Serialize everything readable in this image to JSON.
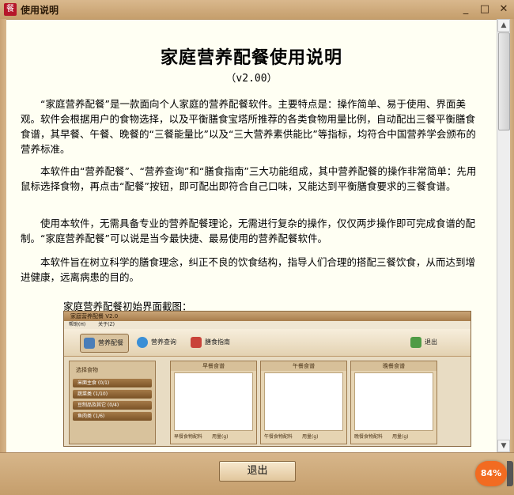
{
  "window": {
    "title": "使用说明",
    "icon": "餐",
    "min_icon": "_",
    "max_icon": "□",
    "close_icon": "✕"
  },
  "doc": {
    "title": "家庭营养配餐使用说明",
    "version": "（v2.00）",
    "paragraphs": [
      "“家庭营养配餐”是一款面向个人家庭的营养配餐软件。主要特点是：操作简单、易于使用、界面美观。软件会根据用户的食物选择，以及平衡膳食宝塔所推荐的各类食物用量比例，自动配出三餐平衡膳食食谱，其早餐、午餐、晚餐的“三餐能量比”以及“三大营养素供能比”等指标，均符合中国营养学会颁布的营养标准。",
      "本软件由“营养配餐”、“营养查询”和“膳食指南”三大功能组成，其中营养配餐的操作非常简单：先用鼠标选择食物，再点击“配餐”按钮，即可配出即符合自己口味，又能达到平衡膳食要求的三餐食谱。",
      "使用本软件，无需具备专业的营养配餐理论，无需进行复杂的操作，仅仅两步操作即可完成食谱的配制。“家庭营养配餐”可以说是当今最快捷、最易使用的营养配餐软件。",
      "本软件旨在树立科学的膳食理念，纠正不良的饮食结构，指导人们合理的搭配三餐饮食，从而达到增进健康，远离病患的目的。"
    ],
    "caption": "家庭营养配餐初始界面截图："
  },
  "screenshot": {
    "title": "家庭营养配餐 V2.0",
    "menu": [
      "帮助(H)",
      "关于(Z)"
    ],
    "toolbar": {
      "peican": "营养配餐",
      "chaxun": "营养查询",
      "zhinan": "膳食指南",
      "exit": "退出"
    },
    "side_header": "选择食物",
    "side_items": [
      "米面主食 (0/1)",
      "蔬菜类 (1/10)",
      "豆制品及其它 (0/4)",
      "鱼肉类 (1/6)"
    ],
    "meals": [
      {
        "name": "早餐食谱",
        "foot": "早餐食物配料　　用量(g)"
      },
      {
        "name": "午餐食谱",
        "foot": "午餐食物配料　　用量(g)"
      },
      {
        "name": "晚餐食谱",
        "foot": "晚餐食物配料　　用量(g)"
      }
    ]
  },
  "footer": {
    "exit_label": "退出"
  },
  "badge": {
    "text": "84%"
  },
  "colors": {
    "frame": "#c59e6c",
    "content_bg": "#fffff3",
    "badge": "#f26b21"
  }
}
